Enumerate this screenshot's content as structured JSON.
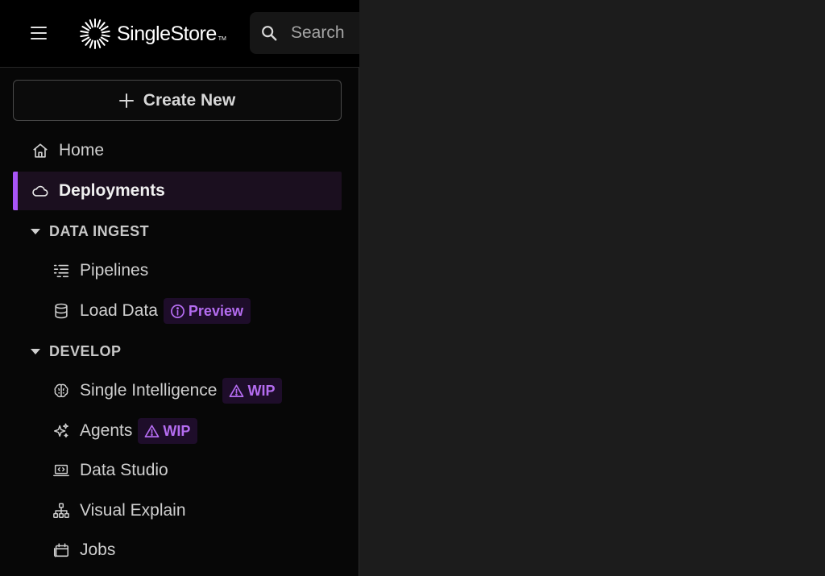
{
  "header": {
    "brand_name": "SingleStore",
    "brand_tm": "TM",
    "search_placeholder": "Search"
  },
  "sidebar": {
    "create_label": "Create New",
    "items": [
      {
        "label": "Home",
        "icon": "home-icon"
      },
      {
        "label": "Deployments",
        "icon": "cloud-icon",
        "selected": true
      }
    ],
    "sections": [
      {
        "title": "DATA INGEST",
        "expanded": true,
        "items": [
          {
            "label": "Pipelines",
            "icon": "pipelines-icon"
          },
          {
            "label": "Load Data",
            "icon": "database-icon",
            "badge": "Preview",
            "badge_icon": "info-icon"
          }
        ]
      },
      {
        "title": "DEVELOP",
        "expanded": true,
        "items": [
          {
            "label": "Single Intelligence",
            "icon": "brain-icon",
            "badge": "WIP",
            "badge_icon": "warning-icon"
          },
          {
            "label": "Agents",
            "icon": "sparkle-icon",
            "badge": "WIP",
            "badge_icon": "warning-icon"
          },
          {
            "label": "Data Studio",
            "icon": "laptop-code-icon"
          },
          {
            "label": "Visual Explain",
            "icon": "hierarchy-icon"
          },
          {
            "label": "Jobs",
            "icon": "calendar-icon"
          }
        ]
      }
    ]
  },
  "theme": {
    "accent": "#a855f7",
    "badge_text": "#b46cf0",
    "badge_bg": "#1e0d2a",
    "panel_bg": "#070707",
    "main_bg": "#1c1c1c"
  }
}
